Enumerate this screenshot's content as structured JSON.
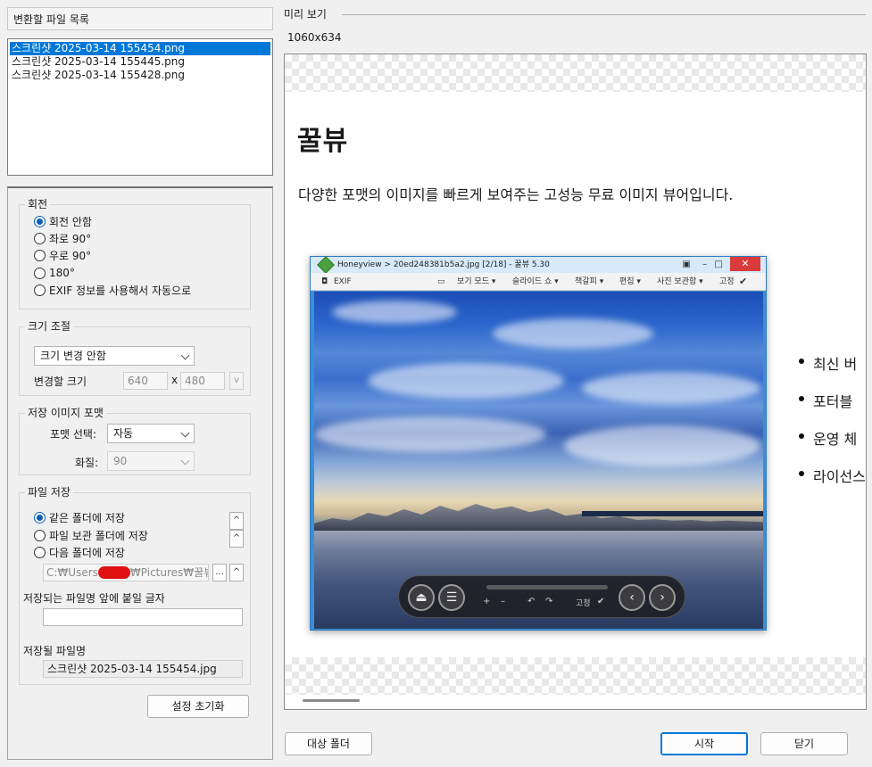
{
  "file_list": {
    "header": "변환할 파일 목록",
    "items": [
      {
        "name": "스크린샷 2025-03-14 155454.png",
        "selected": true
      },
      {
        "name": "스크린샷 2025-03-14 155445.png",
        "selected": false
      },
      {
        "name": "스크린샷 2025-03-14 155428.png",
        "selected": false
      }
    ]
  },
  "rotation": {
    "title": "회전",
    "options": [
      "회전 안함",
      "좌로 90°",
      "우로 90°",
      "180°",
      "EXIF 정보를 사용해서 자동으로"
    ],
    "selected_index": 0
  },
  "resize": {
    "title": "크기 조절",
    "mode_value": "크기 변경 안함",
    "size_label": "변경할 크기",
    "width_placeholder": "640",
    "separator": "x",
    "height_placeholder": "480",
    "unit_button": "v"
  },
  "format": {
    "title": "저장 이미지 포맷",
    "format_label": "포맷 선택:",
    "format_value": "자동",
    "quality_label": "화질:",
    "quality_value": "90"
  },
  "save": {
    "title": "파일 저장",
    "options": [
      "같은 폴더에 저장",
      "파일 보관 폴더에 저장",
      "다음 폴더에 저장"
    ],
    "selected_index": 0,
    "path_prefix": "C:₩Users",
    "path_suffix": "₩Pictures₩꿀뷰",
    "browse_label": "...",
    "prefix_label": "저장되는 파일명 앞에 붙일 글자",
    "prefix_value": "",
    "output_label": "저장될 파일명",
    "output_value": "스크린샷 2025-03-14 155454.jpg",
    "up_arrow": "^"
  },
  "reset_button": "설정 초기화",
  "preview": {
    "label": "미리 보기",
    "dimensions": "1060x634",
    "doc_title": "꿀뷰",
    "doc_description": "다양한 포맷의 이미지를 빠르게 보여주는 고성능 무료 이미지 뷰어입니다.",
    "bullets": [
      "최신 버",
      "포터블",
      "운영 체",
      "라이선스"
    ],
    "hv": {
      "title": "Honeyview > 20ed248381b5a2.jpg [2/18] - 꿀뷰 5.30",
      "exif": "EXIF",
      "tools": [
        "보기 모드 ▾",
        "슬라이드 쇼 ▾",
        "책갈피 ▾",
        "편집 ▾",
        "사진 보관함 ▾",
        "고정"
      ],
      "fixed_label": "고정"
    }
  },
  "footer": {
    "target_folder": "대상 폴더",
    "start": "시작",
    "close": "닫기"
  },
  "colors": {
    "selection": "#0078d7",
    "radio_accent": "#0a5fb4",
    "redaction": "#e01010"
  }
}
